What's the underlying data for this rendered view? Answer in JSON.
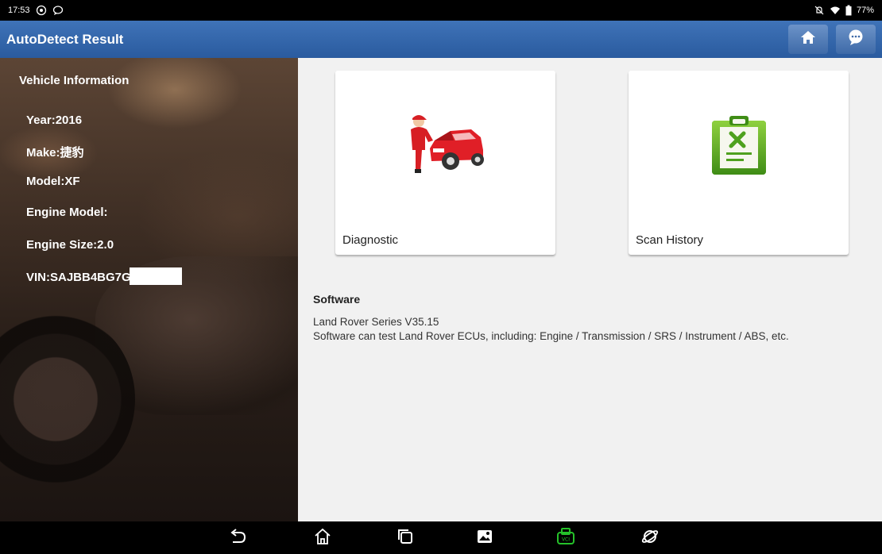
{
  "status_bar": {
    "time": "17:53",
    "battery": "77%"
  },
  "app_bar": {
    "title": "AutoDetect Result"
  },
  "vehicle_info": {
    "heading": "Vehicle Information",
    "year": "Year:2016",
    "make": "Make:捷豹",
    "model": "Model:XF",
    "engine_model": "Engine Model:",
    "engine_size": "Engine Size:2.0",
    "vin": "VIN:SAJBB4BG7G"
  },
  "cards": {
    "diagnostic": "Diagnostic",
    "scan_history": "Scan History"
  },
  "software": {
    "title": "Software",
    "version": "Land Rover Series V35.15",
    "description": "Software can test Land Rover ECUs, including: Engine / Transmission / SRS / Instrument  / ABS, etc."
  },
  "colors": {
    "app_bar": "#2a5b9f",
    "right_bg": "#f1f1f1",
    "vci_icon": "#25c22a"
  }
}
